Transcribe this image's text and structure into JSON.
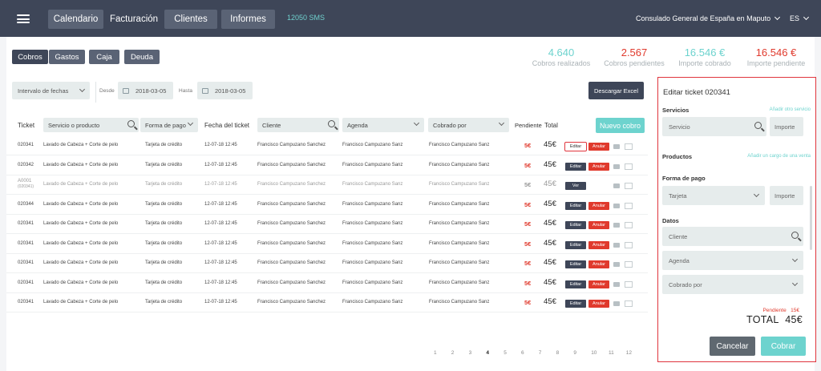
{
  "nav": {
    "items": [
      "Calendario",
      "Facturación",
      "Clientes",
      "Informes"
    ],
    "sms": "12050 SMS",
    "consulado": "Consulado General de España en Maputo",
    "lang": "ES"
  },
  "subtabs": [
    "Cobros",
    "Gastos",
    "Caja",
    "Deuda"
  ],
  "stats": [
    {
      "value": "4.640",
      "label": "Cobros realizados",
      "color": "#6dd3ce"
    },
    {
      "value": "2.567",
      "label": "Cobros pendientes",
      "color": "#e03a2d"
    },
    {
      "value": "16.546 €",
      "label": "Importe cobrado",
      "color": "#6dd3ce"
    },
    {
      "value": "16.546 €",
      "label": "Importe pendiente",
      "color": "#e03a2d"
    }
  ],
  "filters": {
    "interval": "Intervalo de fechas",
    "desde_label": "Desde",
    "desde": "2018-03-05",
    "hasta_label": "Hasta",
    "hasta": "2018-03-05",
    "download": "Descargar Excel",
    "new": "Nuevo cobro"
  },
  "table": {
    "headers": {
      "ticket": "Ticket",
      "servicio": "Servicio o producto",
      "pago": "Forma de pago",
      "fecha": "Fecha del ticket",
      "cliente": "Cliente",
      "agenda": "Agenda",
      "cobrado": "Cobrado por",
      "pendiente": "Pendiente",
      "total": "Total"
    },
    "rows": [
      {
        "ticket": "020341",
        "ticket2": "",
        "servicio": "Lavado de Cabeza + Corte de pelo",
        "pago": "Tarjeta de crédito",
        "fecha": "12-07-18   12:45",
        "cliente": "Francisco Campuzano Sanchez",
        "agenda": "Francisco Campuzano Sanz",
        "cobrado": "Francisco Campuzano Sanz",
        "pendiente": "5€",
        "total": "45€",
        "action": "Editar",
        "anular": "Anular"
      },
      {
        "ticket": "020342",
        "ticket2": "",
        "servicio": "Lavado de Cabeza + Corte de pelo",
        "pago": "Tarjeta de crédito",
        "fecha": "12-07-18   12:45",
        "cliente": "Francisco Campuzano Sanchez",
        "agenda": "Francisco Campuzano Sanz",
        "cobrado": "Francisco Campuzano Sanz",
        "pendiente": "5€",
        "total": "45€",
        "action": "Editar",
        "anular": "Anular"
      },
      {
        "ticket": "A0001",
        "ticket2": "(020341)",
        "servicio": "Lavado de Cabeza + Corte de pelo",
        "pago": "Tarjeta de crédito",
        "fecha": "12-07-18   12:45",
        "cliente": "Francisco Campuzano Sanchez",
        "agenda": "Francisco Campuzano Sanz",
        "cobrado": "Francisco Campuzano Sanz",
        "pendiente": "5€",
        "total": "45€",
        "action": "Ver",
        "anular": ""
      },
      {
        "ticket": "020344",
        "ticket2": "",
        "servicio": "Lavado de Cabeza + Corte de pelo",
        "pago": "Tarjeta de crédito",
        "fecha": "12-07-18   12:45",
        "cliente": "Francisco Campuzano Sanchez",
        "agenda": "Francisco Campuzano Sanz",
        "cobrado": "Francisco Campuzano Sanz",
        "pendiente": "5€",
        "total": "45€",
        "action": "Editar",
        "anular": "Anular"
      },
      {
        "ticket": "020341",
        "ticket2": "",
        "servicio": "Lavado de Cabeza + Corte de pelo",
        "pago": "Tarjeta de crédito",
        "fecha": "12-07-18   12:45",
        "cliente": "Francisco Campuzano Sanchez",
        "agenda": "Francisco Campuzano Sanz",
        "cobrado": "Francisco Campuzano Sanz",
        "pendiente": "5€",
        "total": "45€",
        "action": "Editar",
        "anular": "Anular"
      },
      {
        "ticket": "020341",
        "ticket2": "",
        "servicio": "Lavado de Cabeza + Corte de pelo",
        "pago": "Tarjeta de crédito",
        "fecha": "12-07-18   12:45",
        "cliente": "Francisco Campuzano Sanchez",
        "agenda": "Francisco Campuzano Sanz",
        "cobrado": "Francisco Campuzano Sanz",
        "pendiente": "5€",
        "total": "45€",
        "action": "Editar",
        "anular": "Anular"
      },
      {
        "ticket": "020341",
        "ticket2": "",
        "servicio": "Lavado de Cabeza + Corte de pelo",
        "pago": "Tarjeta de crédito",
        "fecha": "12-07-18   12:45",
        "cliente": "Francisco Campuzano Sanchez",
        "agenda": "Francisco Campuzano Sanz",
        "cobrado": "Francisco Campuzano Sanz",
        "pendiente": "5€",
        "total": "45€",
        "action": "Editar",
        "anular": "Anular"
      },
      {
        "ticket": "020341",
        "ticket2": "",
        "servicio": "Lavado de Cabeza + Corte de pelo",
        "pago": "Tarjeta de crédito",
        "fecha": "12-07-18   12:45",
        "cliente": "Francisco Campuzano Sanchez",
        "agenda": "Francisco Campuzano Sanz",
        "cobrado": "Francisco Campuzano Sanz",
        "pendiente": "5€",
        "total": "45€",
        "action": "Editar",
        "anular": "Anular"
      },
      {
        "ticket": "020341",
        "ticket2": "",
        "servicio": "Lavado de Cabeza + Corte de pelo",
        "pago": "Tarjeta de crédito",
        "fecha": "12-07-18   12:45",
        "cliente": "Francisco Campuzano Sanchez",
        "agenda": "Francisco Campuzano Sanz",
        "cobrado": "Francisco Campuzano Sanz",
        "pendiente": "5€",
        "total": "45€",
        "action": "Editar",
        "anular": "Anular"
      }
    ]
  },
  "pagination": [
    "1",
    "2",
    "3",
    "4",
    "5",
    "6",
    "7",
    "8",
    "9",
    "10",
    "11",
    "12"
  ],
  "pagination_current": "4",
  "panel": {
    "title": "Editar ticket 020341",
    "servicios_label": "Servicios",
    "add_service": "Añadir otro servicio",
    "servicio_placeholder": "Servicio",
    "importe": "Importe",
    "productos_label": "Productos",
    "add_product": "Añadir un cargo de una venta",
    "forma_label": "Forma de pago",
    "tarjeta": "Tarjeta",
    "datos_label": "Datos",
    "cliente": "Cliente",
    "agenda": "Agenda",
    "cobrado": "Cobrado por",
    "pendiente_label": "Pendiente",
    "pendiente_value": "15€",
    "total_label": "TOTAL",
    "total_value": "45€",
    "cancel": "Cancelar",
    "submit": "Cobrar"
  }
}
